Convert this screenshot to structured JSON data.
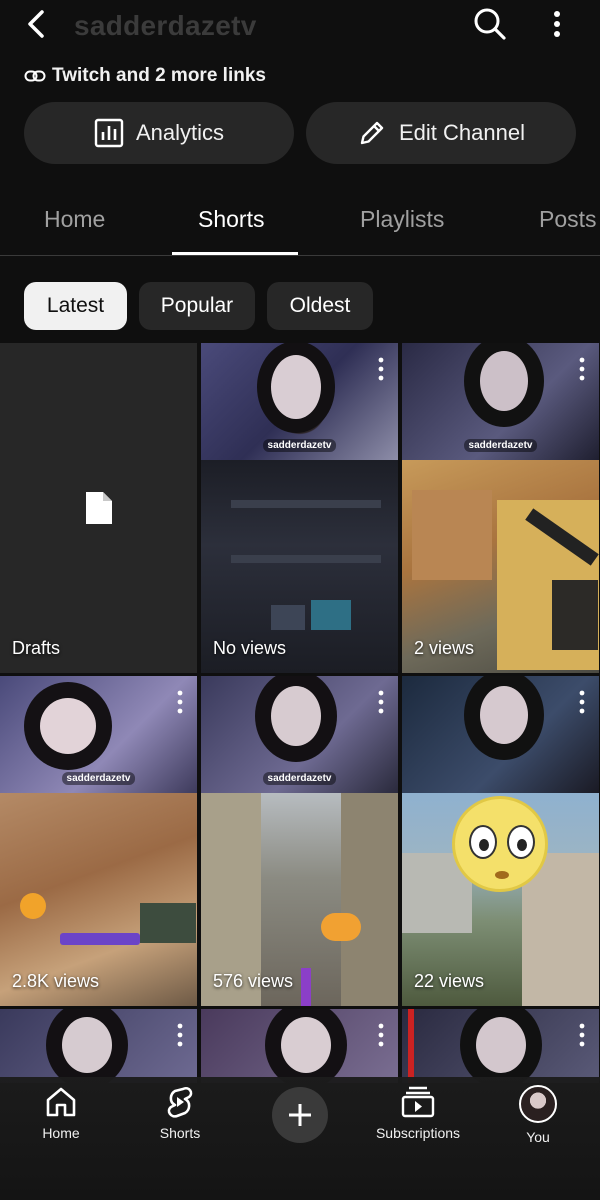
{
  "header": {
    "channel_name": "sadderdazetv",
    "back_icon": "chevron-left-icon",
    "search_icon": "search-icon",
    "more_icon": "more-vertical-icon"
  },
  "links": {
    "text": "Twitch and 2 more links",
    "icon": "link-icon"
  },
  "actions": {
    "analytics_label": "Analytics",
    "analytics_icon": "bar-chart-icon",
    "edit_label": "Edit Channel",
    "edit_icon": "pencil-icon"
  },
  "tabs": [
    {
      "label": "Home"
    },
    {
      "label": "Shorts",
      "active": true
    },
    {
      "label": "Playlists"
    },
    {
      "label": "Posts"
    }
  ],
  "filters": [
    {
      "label": "Latest",
      "active": true
    },
    {
      "label": "Popular"
    },
    {
      "label": "Oldest"
    }
  ],
  "shorts": [
    {
      "type": "drafts",
      "label": "Drafts"
    },
    {
      "label": "No views",
      "watermark": "sadderdazetv"
    },
    {
      "label": "2 views",
      "watermark": "sadderdazetv"
    },
    {
      "label": "2.8K views",
      "watermark": "sadderdazetv"
    },
    {
      "label": "576 views",
      "watermark": "sadderdazetv"
    },
    {
      "label": "22 views"
    }
  ],
  "bottom_nav": [
    {
      "label": "Home",
      "icon": "home-icon"
    },
    {
      "label": "Shorts",
      "icon": "shorts-icon"
    },
    {
      "label": "",
      "icon": "plus-icon"
    },
    {
      "label": "Subscriptions",
      "icon": "subscriptions-icon"
    },
    {
      "label": "You",
      "icon": "avatar"
    }
  ],
  "colors": {
    "background": "#0f0f0f",
    "surface": "#272727",
    "chip_active": "#f1f1f1",
    "text_muted": "#a0a0a0"
  }
}
